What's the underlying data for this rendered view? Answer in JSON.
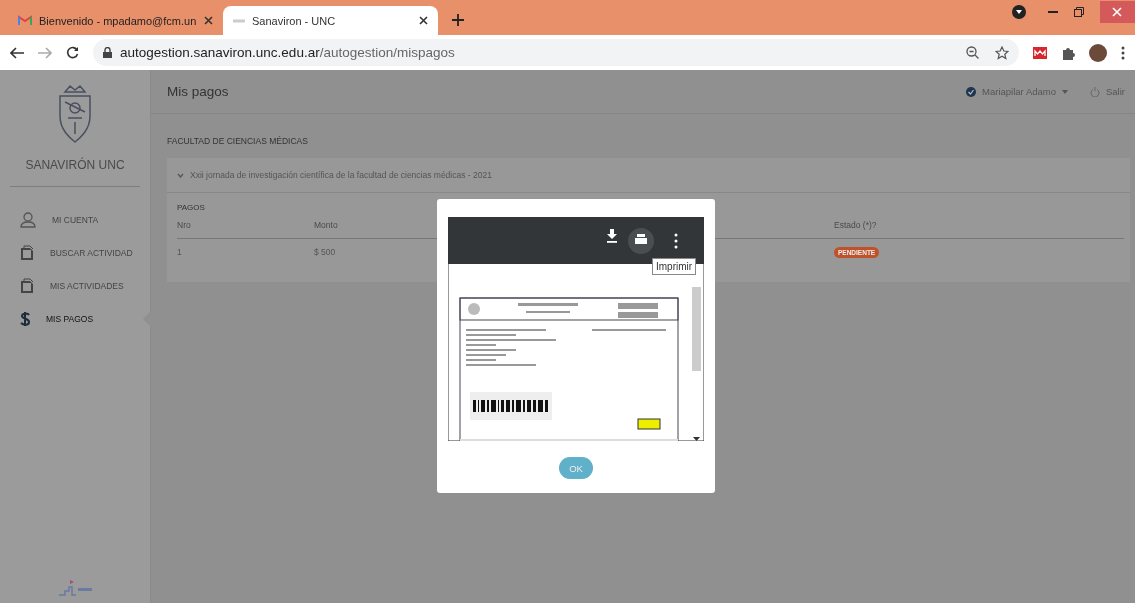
{
  "browser": {
    "tabs": [
      {
        "title": "Bienvenido - mpadamo@fcm.un",
        "selected": false
      },
      {
        "title": "Sanaviron - UNC",
        "selected": true
      }
    ],
    "url_host": "autogestion.sanaviron.unc.edu.ar",
    "url_path": "/autogestion/mispagos"
  },
  "sidebar": {
    "brand": "SANAVIRÓN UNC",
    "items": [
      {
        "label": "MI CUENTA",
        "selected": false
      },
      {
        "label": "BUSCAR ACTIVIDAD",
        "selected": false
      },
      {
        "label": "MIS ACTIVIDADES",
        "selected": false
      },
      {
        "label": "MIS PAGOS",
        "selected": true
      }
    ]
  },
  "header": {
    "title": "Mis pagos",
    "user": "Mariapilar Adamo",
    "logout": "Salir"
  },
  "faculty": "FACULTAD DE CIENCIAS MÉDICAS",
  "activity": {
    "title": "Xxii jornada de investigación científica de la facultad de ciencias médicas - 2021",
    "expanded": true
  },
  "payments": {
    "title": "PAGOS",
    "columns": [
      "Nro",
      "Monto",
      "Estado (*)?"
    ],
    "rows": [
      {
        "nro": "1",
        "monto": "$ 500",
        "estado": "PENDIENTE",
        "color": "#c0522b"
      }
    ]
  },
  "modal": {
    "tooltip": "Imprimir",
    "ok": "OK"
  }
}
